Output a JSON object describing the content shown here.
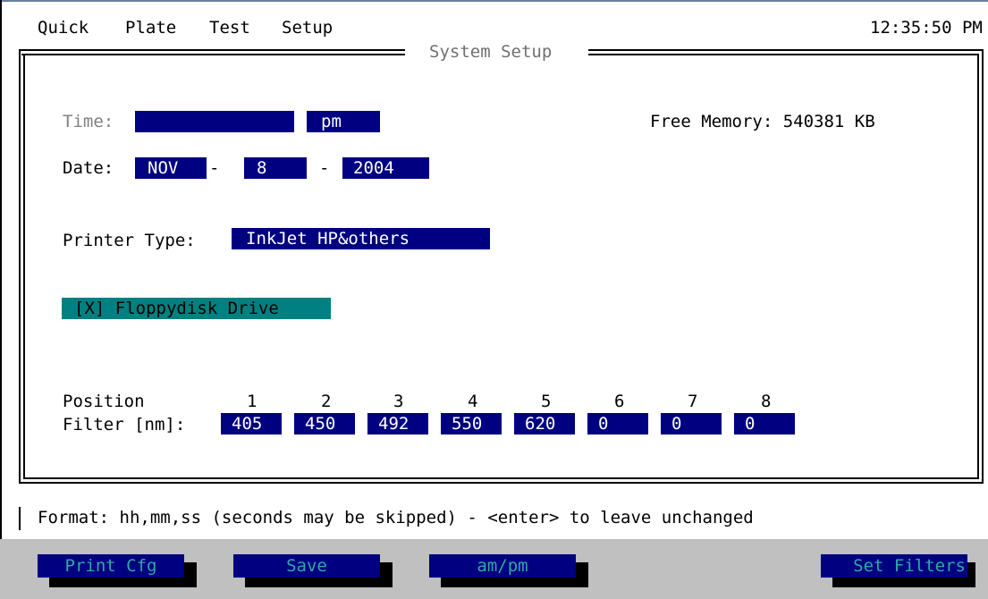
{
  "menu": {
    "items": [
      "Quick",
      "Plate",
      "Test",
      "Setup"
    ],
    "clock": "12:35:50 PM"
  },
  "window": {
    "title": "System Setup"
  },
  "time": {
    "label": "Time:",
    "value": "",
    "ampm": "pm"
  },
  "free_memory": "Free Memory: 540381 KB",
  "date": {
    "label": "Date:",
    "month": "NOV",
    "sep1": "-",
    "day": "8",
    "sep2": "-",
    "year": "2004"
  },
  "printer": {
    "label": "Printer Type:",
    "value": "InkJet HP&others"
  },
  "floppy": {
    "label": "[X] Floppydisk Drive"
  },
  "filters": {
    "position_label": "Position",
    "filter_label": "Filter [nm]:",
    "positions": [
      "1",
      "2",
      "3",
      "4",
      "5",
      "6",
      "7",
      "8"
    ],
    "values": [
      "405",
      "450",
      "492",
      "550",
      "620",
      "0",
      "0",
      "0"
    ]
  },
  "status": {
    "text": "Format: hh,mm,ss (seconds may be skipped) - <enter> to leave unchanged"
  },
  "fkeys": {
    "print_cfg": "Print Cfg",
    "save": "Save",
    "ampm": "am/pm",
    "set_filters": "Set Filters"
  },
  "colors": {
    "field_bg": "#000080",
    "field_fg": "#ffffff",
    "floppy_bg": "#008080",
    "fkey_fg": "#2fa8a8",
    "bottom_bar": "#c0c0c0"
  }
}
